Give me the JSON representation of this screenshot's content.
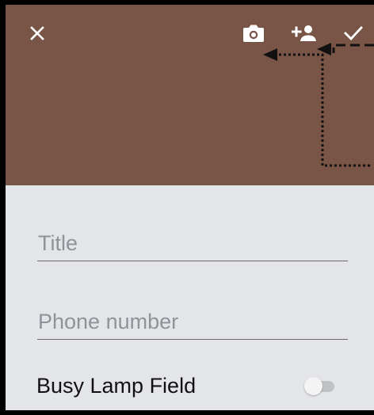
{
  "header": {
    "background_color": "#795548",
    "icons": {
      "close": "close-icon",
      "camera": "camera-icon",
      "add_person": "add-person-icon",
      "save": "check-icon"
    }
  },
  "form": {
    "title_placeholder": "Title",
    "phone_placeholder": "Phone number",
    "busy_lamp_field_label": "Busy Lamp Field",
    "busy_lamp_field_enabled": false
  },
  "colors": {
    "form_background": "#e3e5e8",
    "placeholder_text": "#8f9399",
    "underline": "#6b6b6b",
    "icon": "#ffffff"
  }
}
